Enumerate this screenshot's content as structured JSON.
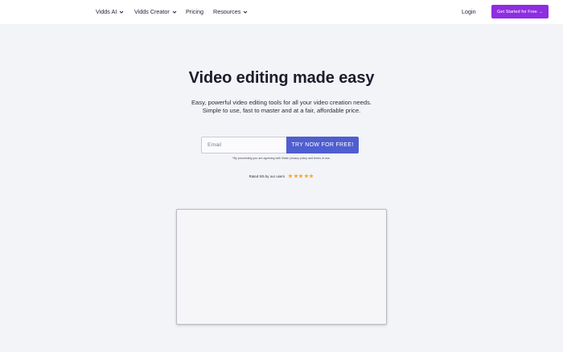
{
  "nav": {
    "items": [
      {
        "label": "Vidds AI",
        "has_dropdown": true
      },
      {
        "label": "Vidds Creator",
        "has_dropdown": true
      },
      {
        "label": "Pricing",
        "has_dropdown": false
      },
      {
        "label": "Resources",
        "has_dropdown": true
      }
    ],
    "login_label": "Login",
    "cta_label": "Get Started for Free →"
  },
  "hero": {
    "title": "Video editing made easy",
    "subtitle_line1": "Easy, powerful video editing tools for all your video creation needs.",
    "subtitle_line2": "Simple to use, fast to master and at a fair, affordable price."
  },
  "signup": {
    "email_placeholder": "Email",
    "button_label": "TRY NOW FOR FREE!",
    "disclaimer_prefix": "*By proceeding you are agreeing with Vidds'",
    "privacy_link": "privacy policy",
    "disclaimer_and": "and",
    "terms_link": "terms of use.",
    "rating_text": "Rated 5/5 by our users",
    "rating_value": 5,
    "rating_max": 5
  },
  "colors": {
    "brand_purple": "#8e2de2",
    "button_blue": "#4f5ed0",
    "star": "#f0ad3c",
    "background": "#f3f4f8"
  }
}
